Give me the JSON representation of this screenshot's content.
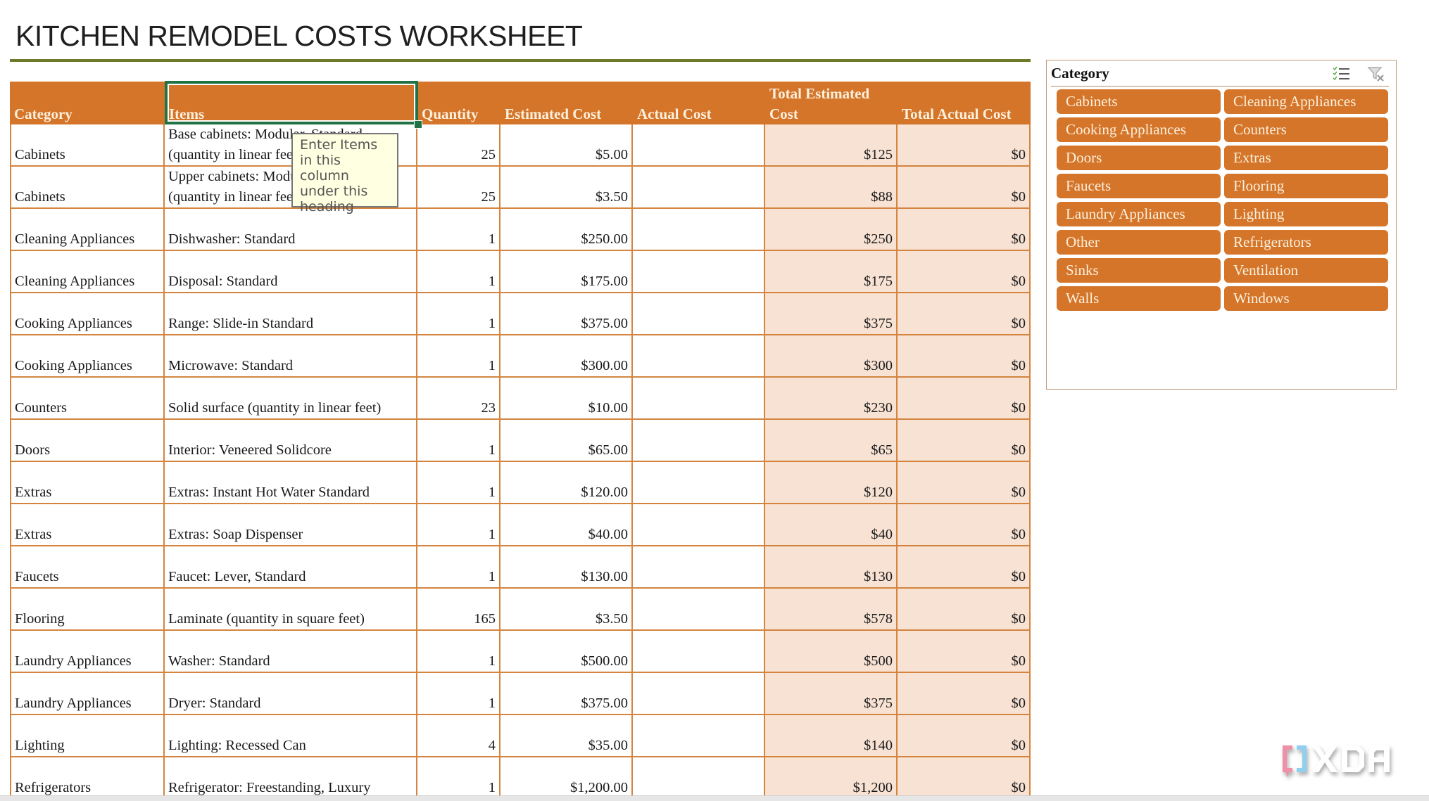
{
  "title": "KITCHEN REMODEL COSTS WORKSHEET",
  "table": {
    "headers": {
      "category": "Category",
      "items": "Items",
      "quantity": "Quantity",
      "estimated_cost": "Estimated Cost",
      "actual_cost": "Actual Cost",
      "total_estimated_cost": "Total Estimated Cost",
      "total_actual_cost": "Total Actual Cost"
    },
    "rows": [
      {
        "category": "Cabinets",
        "item": "Base cabinets: Modular, Standard (quantity in linear feet)",
        "quantity": "25",
        "estimated_cost": "$5.00",
        "actual_cost": "",
        "total_estimated_cost": "$125",
        "total_actual_cost": "$0"
      },
      {
        "category": "Cabinets",
        "item": "Upper cabinets: Modular, Standard (quantity in linear feet)",
        "quantity": "25",
        "estimated_cost": "$3.50",
        "actual_cost": "",
        "total_estimated_cost": "$88",
        "total_actual_cost": "$0"
      },
      {
        "category": "Cleaning Appliances",
        "item": "Dishwasher: Standard",
        "quantity": "1",
        "estimated_cost": "$250.00",
        "actual_cost": "",
        "total_estimated_cost": "$250",
        "total_actual_cost": "$0"
      },
      {
        "category": "Cleaning Appliances",
        "item": "Disposal: Standard",
        "quantity": "1",
        "estimated_cost": "$175.00",
        "actual_cost": "",
        "total_estimated_cost": "$175",
        "total_actual_cost": "$0"
      },
      {
        "category": "Cooking Appliances",
        "item": "Range: Slide-in Standard",
        "quantity": "1",
        "estimated_cost": "$375.00",
        "actual_cost": "",
        "total_estimated_cost": "$375",
        "total_actual_cost": "$0"
      },
      {
        "category": "Cooking Appliances",
        "item": "Microwave: Standard",
        "quantity": "1",
        "estimated_cost": "$300.00",
        "actual_cost": "",
        "total_estimated_cost": "$300",
        "total_actual_cost": "$0"
      },
      {
        "category": "Counters",
        "item": "Solid surface (quantity in linear feet)",
        "quantity": "23",
        "estimated_cost": "$10.00",
        "actual_cost": "",
        "total_estimated_cost": "$230",
        "total_actual_cost": "$0"
      },
      {
        "category": "Doors",
        "item": "Interior: Veneered Solidcore",
        "quantity": "1",
        "estimated_cost": "$65.00",
        "actual_cost": "",
        "total_estimated_cost": "$65",
        "total_actual_cost": "$0"
      },
      {
        "category": "Extras",
        "item": "Extras: Instant Hot Water Standard",
        "quantity": "1",
        "estimated_cost": "$120.00",
        "actual_cost": "",
        "total_estimated_cost": "$120",
        "total_actual_cost": "$0"
      },
      {
        "category": "Extras",
        "item": "Extras: Soap Dispenser",
        "quantity": "1",
        "estimated_cost": "$40.00",
        "actual_cost": "",
        "total_estimated_cost": "$40",
        "total_actual_cost": "$0"
      },
      {
        "category": "Faucets",
        "item": "Faucet: Lever, Standard",
        "quantity": "1",
        "estimated_cost": "$130.00",
        "actual_cost": "",
        "total_estimated_cost": "$130",
        "total_actual_cost": "$0"
      },
      {
        "category": "Flooring",
        "item": "Laminate (quantity in square feet)",
        "quantity": "165",
        "estimated_cost": "$3.50",
        "actual_cost": "",
        "total_estimated_cost": "$578",
        "total_actual_cost": "$0"
      },
      {
        "category": "Laundry Appliances",
        "item": "Washer: Standard",
        "quantity": "1",
        "estimated_cost": "$500.00",
        "actual_cost": "",
        "total_estimated_cost": "$500",
        "total_actual_cost": "$0"
      },
      {
        "category": "Laundry Appliances",
        "item": "Dryer: Standard",
        "quantity": "1",
        "estimated_cost": "$375.00",
        "actual_cost": "",
        "total_estimated_cost": "$375",
        "total_actual_cost": "$0"
      },
      {
        "category": "Lighting",
        "item": "Lighting: Recessed Can",
        "quantity": "4",
        "estimated_cost": "$35.00",
        "actual_cost": "",
        "total_estimated_cost": "$140",
        "total_actual_cost": "$0"
      },
      {
        "category": "Refrigerators",
        "item": "Refrigerator: Freestanding, Luxury",
        "quantity": "1",
        "estimated_cost": "$1,200.00",
        "actual_cost": "",
        "total_estimated_cost": "$1,200",
        "total_actual_cost": "$0"
      }
    ]
  },
  "tooltip": {
    "text": "Enter Items in this column under this heading"
  },
  "slicer": {
    "title": "Category",
    "multi_select_icon": "multi-select-icon",
    "clear_filter_icon": "clear-filter-icon",
    "items": [
      "Cabinets",
      "Cleaning Appliances",
      "Cooking Appliances",
      "Counters",
      "Doors",
      "Extras",
      "Faucets",
      "Flooring",
      "Laundry Appliances",
      "Lighting",
      "Other",
      "Refrigerators",
      "Sinks",
      "Ventilation",
      "Walls",
      "Windows"
    ]
  },
  "colors": {
    "accent_orange": "#d4752a",
    "header_text": "#fdf0dc",
    "total_fill": "#f7e2d3",
    "title_rule": "#6b7a2b",
    "selection": "#217346"
  },
  "watermark": "XDA"
}
